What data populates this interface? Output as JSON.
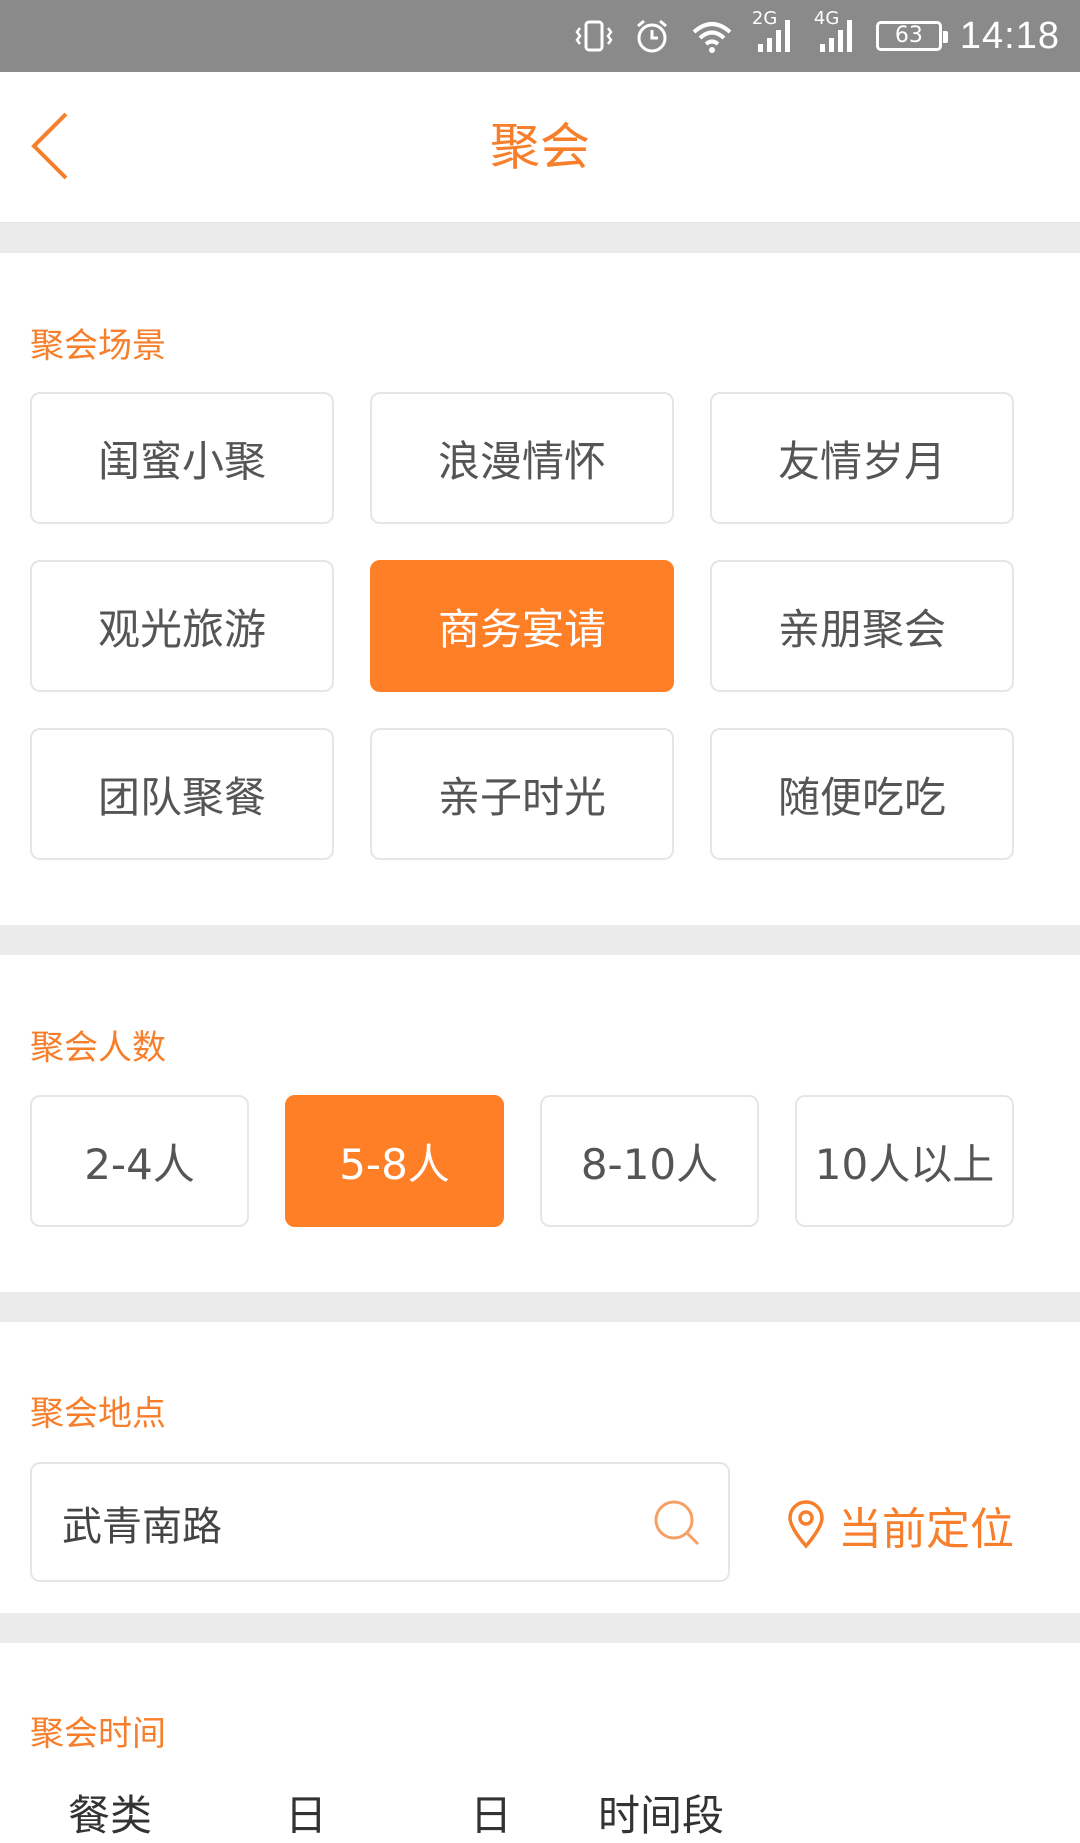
{
  "status_bar": {
    "signal1_label": "2G",
    "signal2_label": "4G",
    "battery": "63",
    "time": "14:18"
  },
  "nav": {
    "title": "聚会"
  },
  "scene": {
    "label": "聚会场景",
    "options": [
      "闺蜜小聚",
      "浪漫情怀",
      "友情岁月",
      "观光旅游",
      "商务宴请",
      "亲朋聚会",
      "团队聚餐",
      "亲子时光",
      "随便吃吃"
    ],
    "selected": "商务宴请"
  },
  "people": {
    "label": "聚会人数",
    "options": [
      "2-4人",
      "5-8人",
      "8-10人",
      "10人以上"
    ],
    "selected": "5-8人"
  },
  "location": {
    "label": "聚会地点",
    "value": "武青南路",
    "locate_label": "当前定位"
  },
  "time": {
    "label": "聚会时间",
    "columns": [
      "餐类",
      "日",
      "日",
      "时间段"
    ]
  },
  "colors": {
    "accent": "#ff7f27",
    "status_bar": "#8a8a8a",
    "section_gap": "#ebebeb"
  },
  "icons": [
    "vibrate-icon",
    "alarm-icon",
    "wifi-icon",
    "signal-icon",
    "battery-icon",
    "back-arrow-icon",
    "search-icon",
    "location-pin-icon"
  ]
}
